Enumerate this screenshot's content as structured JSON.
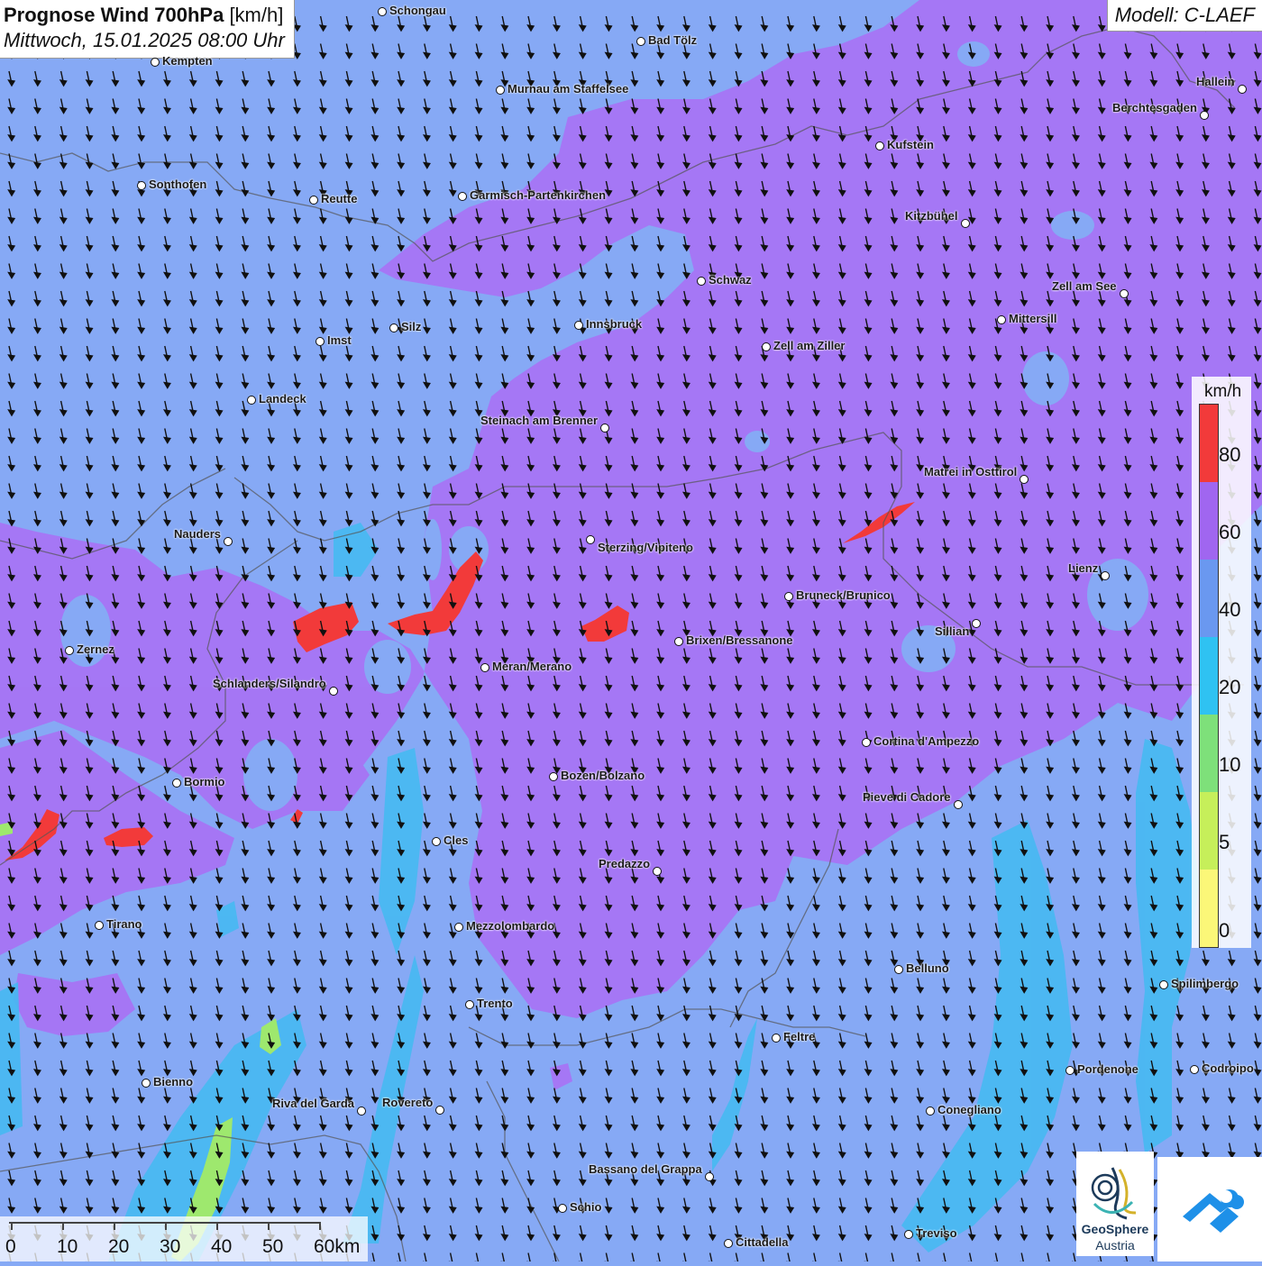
{
  "title": {
    "main": "Prognose Wind 700hPa",
    "unit": "[km/h]",
    "datetime": "Mittwoch, 15.01.2025 08:00 Uhr"
  },
  "model_label": "Modell: C-LAEF",
  "legend": {
    "unit": "km/h",
    "classes": [
      {
        "label": "80",
        "color": "#f23a3a"
      },
      {
        "label": "60",
        "color": "#a066f0"
      },
      {
        "label": "40",
        "color": "#6a98f0"
      },
      {
        "label": "20",
        "color": "#2fc2f2"
      },
      {
        "label": "10",
        "color": "#7ee07a"
      },
      {
        "label": "5",
        "color": "#c6ef5a"
      },
      {
        "label": "0",
        "color": "#fbf778"
      }
    ]
  },
  "scale": {
    "ticks": [
      "0",
      "10",
      "20",
      "30",
      "40",
      "50",
      "60km"
    ]
  },
  "logo": {
    "line1": "GeoSphere",
    "line2": "Austria"
  },
  "wind_direction": "north-northwest",
  "cities": [
    {
      "name": "Schongau"
    },
    {
      "name": "Bad Tölz"
    },
    {
      "name": "Kempten"
    },
    {
      "name": "Murnau am Staffelsee"
    },
    {
      "name": "Hallein"
    },
    {
      "name": "Berchtesgaden"
    },
    {
      "name": "Kufstein"
    },
    {
      "name": "Sonthofen"
    },
    {
      "name": "Reutte"
    },
    {
      "name": "Garmisch-Partenkirchen"
    },
    {
      "name": "Kitzbühel"
    },
    {
      "name": "Schwaz"
    },
    {
      "name": "Zell am See"
    },
    {
      "name": "Mittersill"
    },
    {
      "name": "Innsbruck"
    },
    {
      "name": "Silz"
    },
    {
      "name": "Imst"
    },
    {
      "name": "Zell am Ziller"
    },
    {
      "name": "Landeck"
    },
    {
      "name": "Steinach am Brenner"
    },
    {
      "name": "Matrei in Osttirol"
    },
    {
      "name": "Nauders"
    },
    {
      "name": "Sterzing/Vipiteno"
    },
    {
      "name": "Lienz"
    },
    {
      "name": "Bruneck/Brunico"
    },
    {
      "name": "Sillian"
    },
    {
      "name": "Zernez"
    },
    {
      "name": "Brixen/Bressanone"
    },
    {
      "name": "Meran/Merano"
    },
    {
      "name": "Schlanders/Silandro"
    },
    {
      "name": "Cortina d'Ampezzo"
    },
    {
      "name": "Bozen/Bolzano"
    },
    {
      "name": "Bormio"
    },
    {
      "name": "Pieve di Cadore"
    },
    {
      "name": "Cles"
    },
    {
      "name": "Predazzo"
    },
    {
      "name": "Tirano"
    },
    {
      "name": "Mezzolombardo"
    },
    {
      "name": "Belluno"
    },
    {
      "name": "Spilimbergo"
    },
    {
      "name": "Trento"
    },
    {
      "name": "Feltre"
    },
    {
      "name": "Pordenone"
    },
    {
      "name": "Codroipo"
    },
    {
      "name": "Bienno"
    },
    {
      "name": "Riva del Garda"
    },
    {
      "name": "Rovereto"
    },
    {
      "name": "Conegliano"
    },
    {
      "name": "Bassano del Grappa"
    },
    {
      "name": "Schio"
    },
    {
      "name": "Treviso"
    },
    {
      "name": "Cittadella"
    }
  ]
}
